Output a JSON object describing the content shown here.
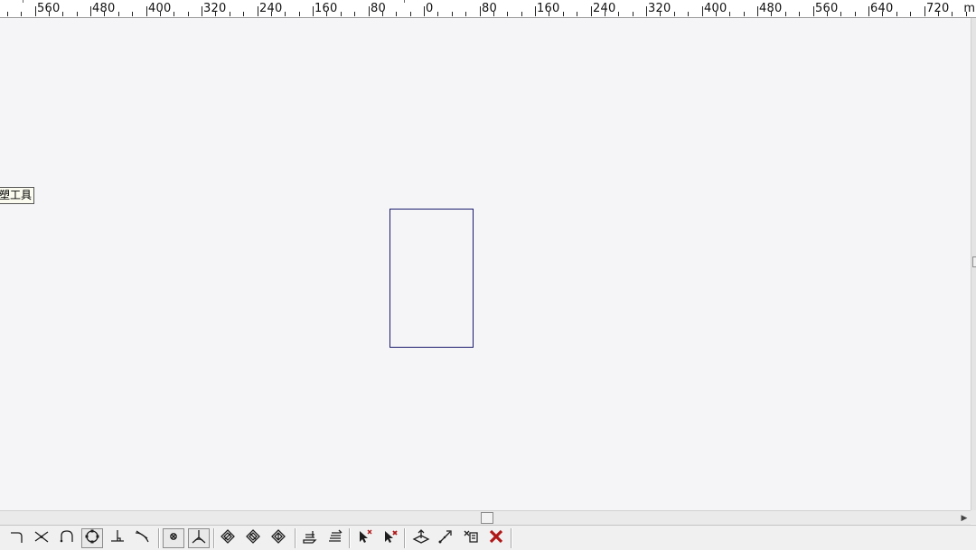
{
  "ruler": {
    "labels": [
      "560",
      "480",
      "400",
      "320",
      "240",
      "160",
      "80",
      "0",
      "80",
      "160",
      "240",
      "320",
      "400",
      "480",
      "560",
      "640",
      "720"
    ],
    "unit": "m"
  },
  "tooltip": {
    "text": "塑工具"
  },
  "toolbar": {
    "buttons": [
      {
        "name": "fillet-icon"
      },
      {
        "name": "trim-icon"
      },
      {
        "name": "arc-tool-icon"
      },
      {
        "name": "circle-tool-icon"
      },
      {
        "name": "perpendicular-icon"
      },
      {
        "name": "tangent-icon"
      },
      {
        "name": "snap-point-icon"
      },
      {
        "name": "angle-snap-icon"
      },
      {
        "name": "rotate-plane-icon"
      },
      {
        "name": "rotate-plane-alt-icon"
      },
      {
        "name": "rotate-plane-cw-icon"
      },
      {
        "name": "extrude-icon"
      },
      {
        "name": "extrude-multi-icon"
      },
      {
        "name": "select-delete-icon"
      },
      {
        "name": "select-delete-alt-icon"
      },
      {
        "name": "face-transform-icon"
      },
      {
        "name": "move-node-icon"
      },
      {
        "name": "delete-paste-icon"
      },
      {
        "name": "close-icon"
      }
    ]
  },
  "colors": {
    "shape_stroke": "#1a1a6e",
    "close": "#b01818",
    "canvas": "#f5f5f7"
  }
}
